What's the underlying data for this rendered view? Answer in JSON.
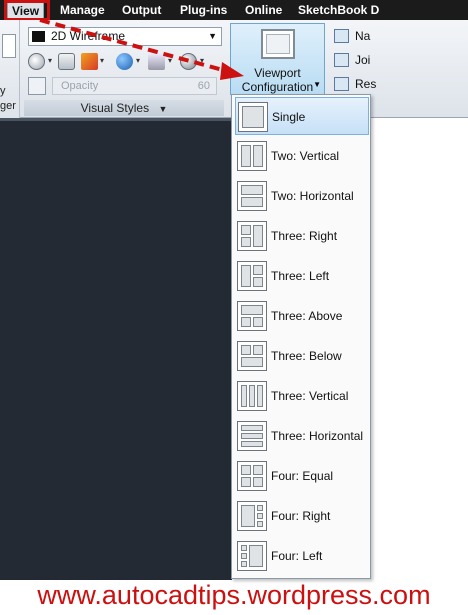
{
  "menubar": {
    "tabs": [
      "View",
      "Manage",
      "Output",
      "Plug-ins",
      "Online",
      "SketchBook D"
    ]
  },
  "ribbon": {
    "left_stub_text": [
      "y",
      "ger"
    ],
    "visual_styles": {
      "combo_value": "2D Wireframe",
      "opacity_label": "Opacity",
      "opacity_value": "60",
      "panel_title": "Visual Styles"
    },
    "viewport_button": {
      "line1": "Viewport",
      "line2": "Configuration"
    },
    "side_items": [
      "Na",
      "Joi",
      "Res"
    ]
  },
  "dropdown": {
    "items": [
      {
        "label": "Single",
        "selected": true
      },
      {
        "label": "Two: Vertical"
      },
      {
        "label": "Two: Horizontal"
      },
      {
        "label": "Three: Right"
      },
      {
        "label": "Three: Left"
      },
      {
        "label": "Three: Above"
      },
      {
        "label": "Three: Below"
      },
      {
        "label": "Three: Vertical"
      },
      {
        "label": "Three: Horizontal"
      },
      {
        "label": "Four: Equal"
      },
      {
        "label": "Four: Right"
      },
      {
        "label": "Four: Left"
      }
    ]
  },
  "footer": {
    "url": "www.autocadtips.wordpress.com"
  },
  "colors": {
    "highlight_red": "#cc1111",
    "menubar_bg": "#1b1b1b",
    "drawing_bg": "#242a33"
  }
}
